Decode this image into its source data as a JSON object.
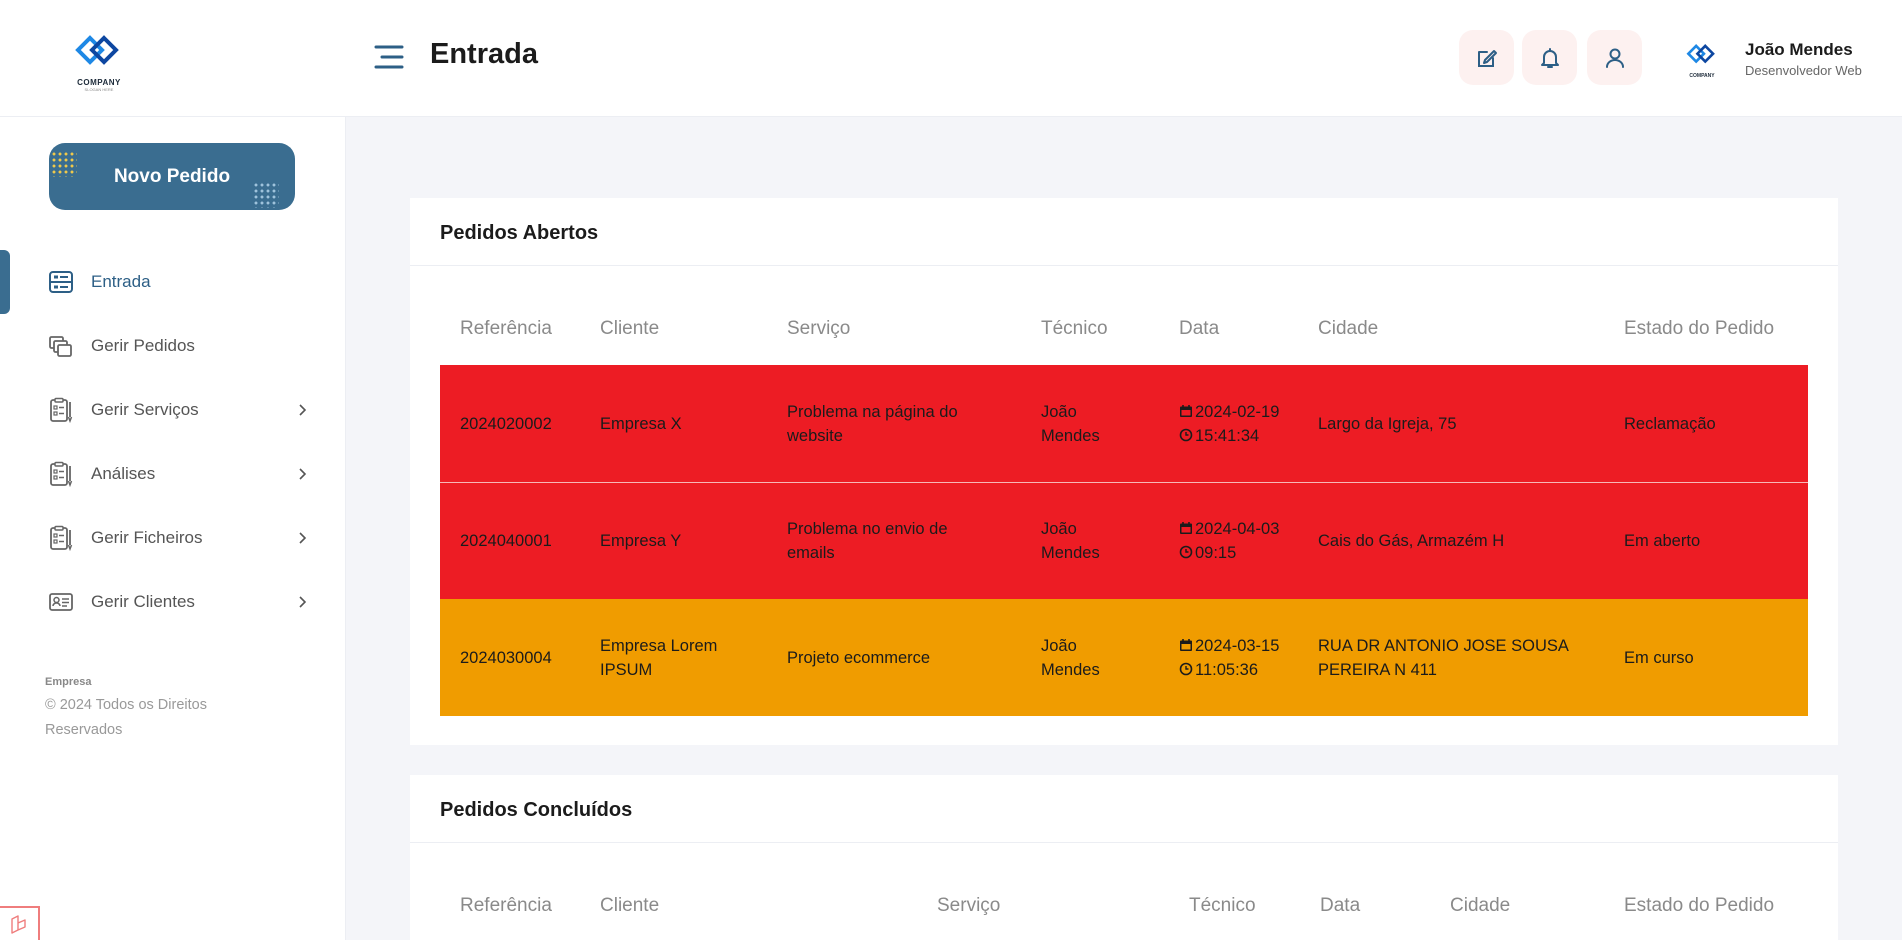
{
  "header": {
    "logo_text": "COMPANY",
    "logo_subtext": "SLOGAN HERE",
    "title": "Entrada",
    "profile_logo_text": "COMPANY",
    "user_name": "João Mendes",
    "user_role": "Desenvolvedor Web"
  },
  "sidebar": {
    "new_order_label": "Novo Pedido",
    "items": [
      {
        "label": "Entrada",
        "icon": "inbox-icon",
        "active": true,
        "has_chevron": false
      },
      {
        "label": "Gerir Pedidos",
        "icon": "stack-icon",
        "active": false,
        "has_chevron": false
      },
      {
        "label": "Gerir Serviços",
        "icon": "clipboard-icon",
        "active": false,
        "has_chevron": true
      },
      {
        "label": "Análises",
        "icon": "clipboard-icon",
        "active": false,
        "has_chevron": true
      },
      {
        "label": "Gerir Ficheiros",
        "icon": "clipboard-icon",
        "active": false,
        "has_chevron": true
      },
      {
        "label": "Gerir Clientes",
        "icon": "id-card-icon",
        "active": false,
        "has_chevron": true
      }
    ],
    "footer_company": "Empresa",
    "footer_copyright": "© 2024 Todos os Direitos Reservados"
  },
  "open_orders": {
    "title": "Pedidos Abertos",
    "columns": [
      "Referência",
      "Cliente",
      "Serviço",
      "Técnico",
      "Data",
      "Cidade",
      "Estado do Pedido"
    ],
    "rows": [
      {
        "ref": "2024020002",
        "client": "Empresa X",
        "service": "Problema na página do website",
        "tech": "João Mendes",
        "date": "2024-02-19",
        "time": "15:41:34",
        "city": "Largo da Igreja, 75",
        "status": "Reclamação",
        "color": "#ed1c24"
      },
      {
        "ref": "2024040001",
        "client": "Empresa Y",
        "service": "Problema no envio de emails",
        "tech": "João Mendes",
        "date": "2024-04-03",
        "time": "09:15",
        "city": "Cais do Gás, Armazém H",
        "status": "Em aberto",
        "color": "#ed1c24"
      },
      {
        "ref": "2024030004",
        "client": "Empresa Lorem IPSUM",
        "service": "Projeto ecommerce",
        "tech": "João Mendes",
        "date": "2024-03-15",
        "time": "11:05:36",
        "city": "RUA DR ANTONIO JOSE SOUSA PEREIRA N 411",
        "status": "Em curso",
        "color": "#f09c00"
      }
    ]
  },
  "closed_orders": {
    "title": "Pedidos Concluídos",
    "columns": [
      "Referência",
      "Cliente",
      "Serviço",
      "Técnico",
      "Data",
      "Cidade",
      "Estado do Pedido"
    ]
  }
}
